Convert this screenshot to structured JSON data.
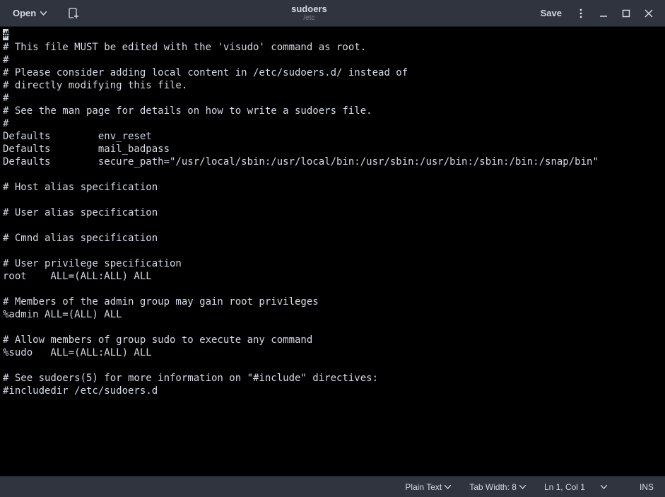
{
  "titlebar": {
    "open_label": "Open",
    "title": "sudoers",
    "subtitle": "/etc",
    "save_label": "Save"
  },
  "editor": {
    "content": "#\n# This file MUST be edited with the 'visudo' command as root.\n#\n# Please consider adding local content in /etc/sudoers.d/ instead of\n# directly modifying this file.\n#\n# See the man page for details on how to write a sudoers file.\n#\nDefaults        env_reset\nDefaults        mail_badpass\nDefaults        secure_path=\"/usr/local/sbin:/usr/local/bin:/usr/sbin:/usr/bin:/sbin:/bin:/snap/bin\"\n\n# Host alias specification\n\n# User alias specification\n\n# Cmnd alias specification\n\n# User privilege specification\nroot    ALL=(ALL:ALL) ALL\n\n# Members of the admin group may gain root privileges\n%admin ALL=(ALL) ALL\n\n# Allow members of group sudo to execute any command\n%sudo   ALL=(ALL:ALL) ALL\n\n# See sudoers(5) for more information on \"#include\" directives:\n#includedir /etc/sudoers.d"
  },
  "statusbar": {
    "syntax": "Plain Text",
    "tab_width": "Tab Width: 8",
    "position": "Ln 1, Col 1",
    "insert_mode": "INS"
  }
}
